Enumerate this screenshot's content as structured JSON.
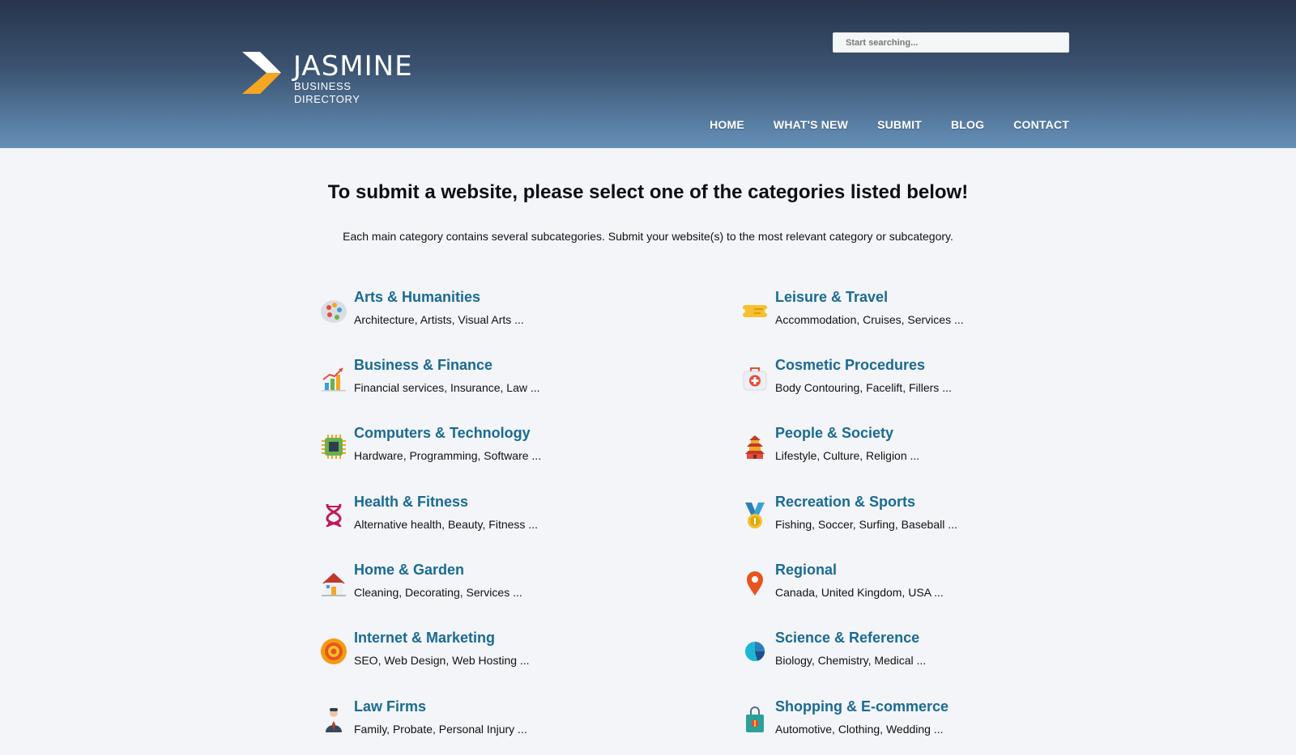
{
  "header": {
    "logo_title": "JASMINE",
    "logo_sub": "BUSINESS DIRECTORY",
    "search_placeholder": "Start searching...",
    "nav": [
      "HOME",
      "WHAT'S NEW",
      "SUBMIT",
      "BLOG",
      "CONTACT"
    ]
  },
  "page": {
    "title": "To submit a website, please select one of the categories listed below!",
    "subtitle": "Each main category contains several subcategories. Submit your website(s) to the most relevant category or subcategory."
  },
  "categories": [
    {
      "name": "Arts & Humanities",
      "desc": "Architecture, Artists, Visual Arts ...",
      "icon": "palette-icon"
    },
    {
      "name": "Leisure & Travel",
      "desc": "Accommodation, Cruises, Services ...",
      "icon": "ticket-icon"
    },
    {
      "name": "Business & Finance",
      "desc": "Financial services, Insurance, Law ...",
      "icon": "bar-chart-icon"
    },
    {
      "name": "Cosmetic Procedures",
      "desc": "Body Contouring, Facelift, Fillers ...",
      "icon": "first-aid-kit-icon"
    },
    {
      "name": "Computers & Technology",
      "desc": "Hardware, Programming, Software ...",
      "icon": "cpu-chip-icon"
    },
    {
      "name": "People & Society",
      "desc": "Lifestyle, Culture, Religion ...",
      "icon": "pagoda-icon"
    },
    {
      "name": "Health & Fitness",
      "desc": "Alternative health, Beauty, Fitness ...",
      "icon": "dna-icon"
    },
    {
      "name": "Recreation & Sports",
      "desc": "Fishing, Soccer, Surfing, Baseball ...",
      "icon": "medal-icon"
    },
    {
      "name": "Home & Garden",
      "desc": "Cleaning, Decorating, Services ...",
      "icon": "house-icon"
    },
    {
      "name": "Regional",
      "desc": "Canada, United Kingdom, USA ...",
      "icon": "map-pin-icon"
    },
    {
      "name": "Internet & Marketing",
      "desc": "SEO, Web Design, Web Hosting ...",
      "icon": "target-icon"
    },
    {
      "name": "Science & Reference",
      "desc": "Biology, Chemistry, Medical ...",
      "icon": "pie-chart-icon"
    },
    {
      "name": "Law Firms",
      "desc": "Family, Probate, Personal Injury ...",
      "icon": "lawyer-icon"
    },
    {
      "name": "Shopping & E-commerce",
      "desc": "Automotive, Clothing, Wedding ...",
      "icon": "shopping-bag-icon"
    }
  ]
}
